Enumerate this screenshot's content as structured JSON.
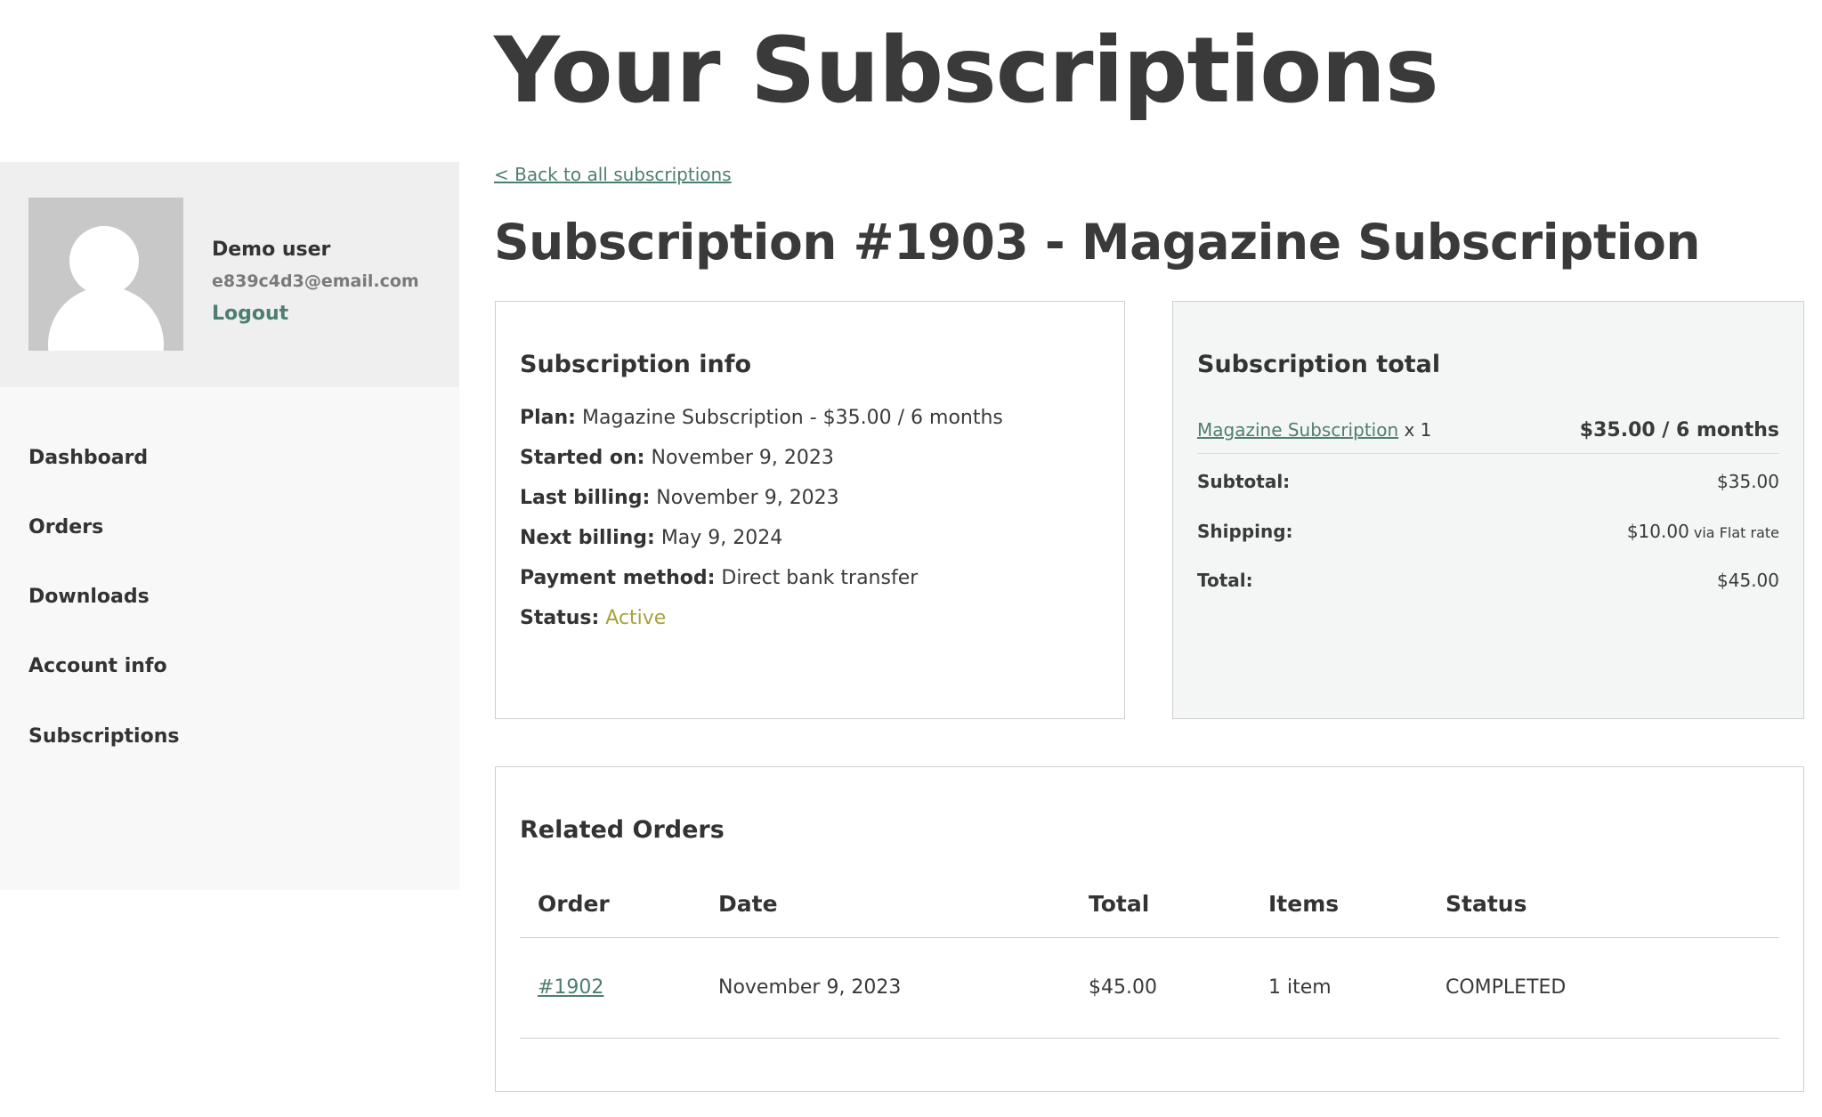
{
  "page_title": "Your Subscriptions",
  "user": {
    "name": "Demo user",
    "email": "e839c4d3@email.com",
    "logout_label": "Logout"
  },
  "nav": {
    "items": [
      {
        "label": "Dashboard"
      },
      {
        "label": "Orders"
      },
      {
        "label": "Downloads"
      },
      {
        "label": "Account info"
      },
      {
        "label": "Subscriptions"
      }
    ]
  },
  "back_link": "< Back to all subscriptions",
  "subscription_title": "Subscription #1903 - Magazine Subscription",
  "info": {
    "heading": "Subscription info",
    "rows": [
      {
        "label": "Plan:",
        "value": "Magazine Subscription - $35.00 / 6 months"
      },
      {
        "label": "Started on:",
        "value": "November 9, 2023"
      },
      {
        "label": "Last billing:",
        "value": "November 9, 2023"
      },
      {
        "label": "Next billing:",
        "value": "May 9, 2024"
      },
      {
        "label": "Payment method:",
        "value": "Direct bank transfer"
      },
      {
        "label": "Status:",
        "value": "Active"
      }
    ]
  },
  "totals": {
    "heading": "Subscription total",
    "product_link": "Magazine Subscription",
    "product_qty": " x 1",
    "product_price": "$35.00 / 6 months",
    "subtotal_label": "Subtotal:",
    "subtotal_value": "$35.00",
    "shipping_label": "Shipping:",
    "shipping_value": "$10.00",
    "shipping_method": " via Flat rate",
    "total_label": "Total:",
    "total_value": "$45.00"
  },
  "related": {
    "heading": "Related Orders",
    "columns": [
      "Order",
      "Date",
      "Total",
      "Items",
      "Status"
    ],
    "rows": [
      {
        "order": "#1902",
        "date": "November 9, 2023",
        "total": "$45.00",
        "items": "1 item",
        "status": "COMPLETED"
      }
    ]
  },
  "colors": {
    "accent": "#4e7e72",
    "status_active": "#a8a23a",
    "text": "#3a3a3a"
  }
}
